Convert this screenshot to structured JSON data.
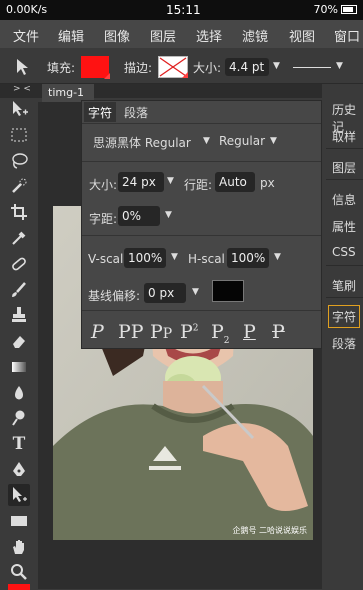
{
  "status": {
    "network": "0.00K/s",
    "time": "15:11",
    "battery": "70%"
  },
  "menu": [
    "文件",
    "编辑",
    "图像",
    "图层",
    "选择",
    "滤镜",
    "视图",
    "窗口"
  ],
  "options": {
    "fill_label": "填充:",
    "stroke_label": "描边:",
    "size_label": "大小:",
    "size_value": "4.4 pt",
    "fill_color": "#ff1212"
  },
  "doc_tab": "timg-1",
  "collapse_left": "> <",
  "collapse_right": "> <",
  "char_panel": {
    "tabs": [
      "字符",
      "段落"
    ],
    "font_family": "思源黑体 Regular",
    "font_style": "Regular",
    "size_label": "大小:",
    "size_value": "24 px",
    "leading_label": "行距:",
    "leading_value": "Auto",
    "leading_unit": "px",
    "tracking_label": "字距:",
    "tracking_value": "0%",
    "vscale_label": "V-scal",
    "vscale_value": "100%",
    "hscale_label": "H-scal",
    "hscale_value": "100%",
    "baseline_label": "基线偏移:",
    "baseline_value": "0 px",
    "text_color": "#050505"
  },
  "right_panel": [
    "历史记",
    "取样",
    "图层",
    "信息",
    "属性",
    "CSS",
    "笔刷",
    "字符",
    "段落"
  ],
  "watermark": "企鹅号 二哈说说娱乐"
}
